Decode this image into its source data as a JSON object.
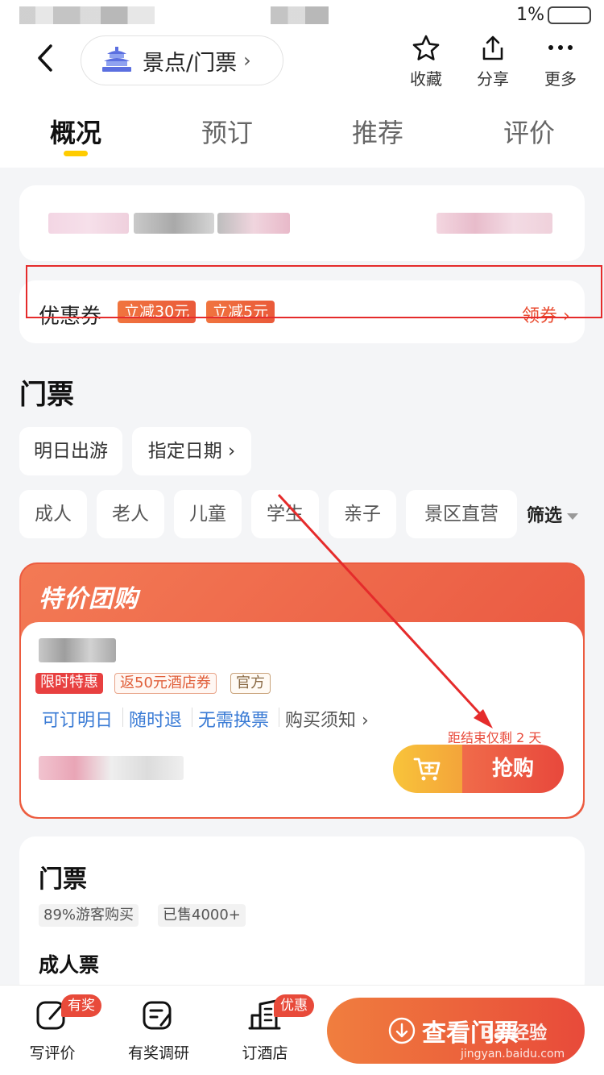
{
  "status_bar": {
    "battery": "1%"
  },
  "nav": {
    "breadcrumb": "景点/门票",
    "actions": {
      "favorite": "收藏",
      "share": "分享",
      "more": "更多"
    }
  },
  "tabs": [
    "概况",
    "预订",
    "推荐",
    "评价"
  ],
  "coupon": {
    "title": "优惠券",
    "tags": [
      "立减30元",
      "立减5元"
    ],
    "get": "领券"
  },
  "tickets": {
    "title": "门票",
    "date_options": [
      "明日出游",
      "指定日期"
    ],
    "filters": [
      "成人",
      "老人",
      "儿童",
      "学生",
      "亲子",
      "景区直营"
    ],
    "filter_button": "筛选"
  },
  "deal": {
    "header": "特价团购",
    "tags": [
      "限时特惠",
      "返50元酒店券",
      "官方"
    ],
    "features": [
      "可订明日",
      "随时退",
      "无需换票"
    ],
    "notice": "购买须知",
    "countdown": "距结束仅剩 2 天",
    "buy_label": "抢购"
  },
  "ticket_card": {
    "title": "门票",
    "stats": [
      "89%游客购买",
      "已售4000+"
    ],
    "subtitle": "成人票"
  },
  "bottom_bar": {
    "items": [
      {
        "label": "写评价",
        "badge": "有奖"
      },
      {
        "label": "有奖调研"
      },
      {
        "label": "订酒店",
        "badge": "优惠"
      }
    ],
    "cta": "查看门票"
  },
  "watermark": {
    "brand": "Bai经验",
    "url": "jingyan.baidu.com"
  },
  "colors": {
    "accent": "#e84a3a",
    "tab_underline": "#ffcc00",
    "link_blue": "#3a7bd5",
    "annotation_red": "#e52b2b"
  }
}
